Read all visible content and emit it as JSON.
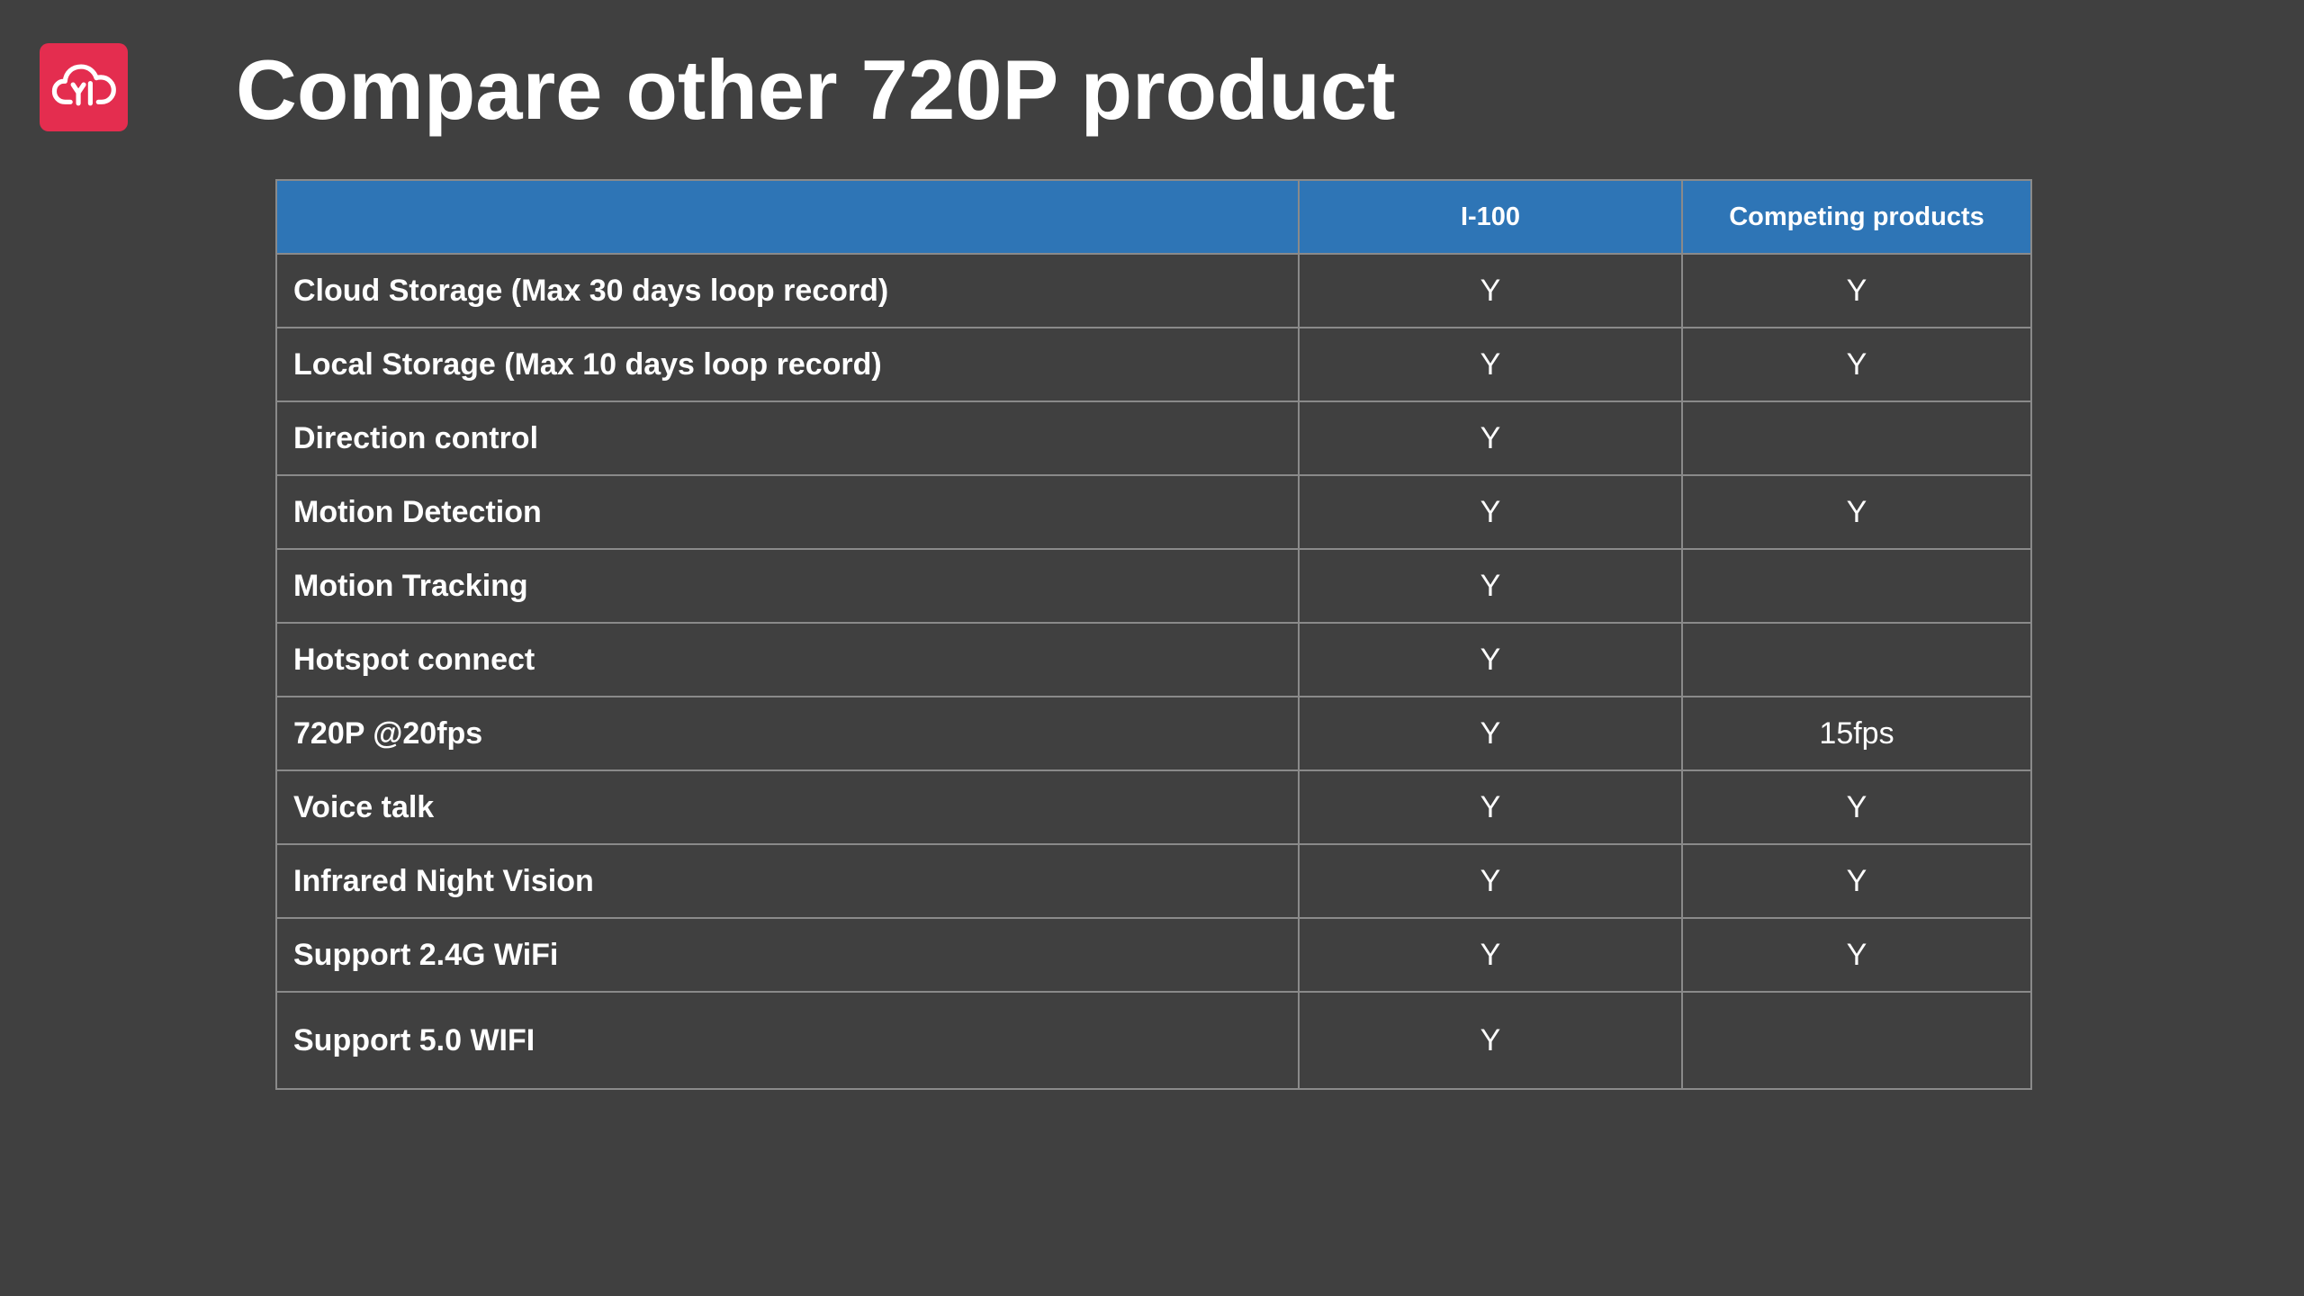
{
  "title": "Compare other 720P product",
  "logo": {
    "icon": "cloud-yi-logo-icon",
    "color": "#e42d4f"
  },
  "colors": {
    "background": "#404040",
    "header": "#2e75b6",
    "grid": "#8a8a8a"
  },
  "table": {
    "headers": [
      "",
      "I-100",
      "Competing products"
    ],
    "rows": [
      {
        "feature": "Cloud Storage (Max 30 days loop record)",
        "i100": "Y",
        "competing": "Y"
      },
      {
        "feature": "Local Storage (Max 10 days loop record)",
        "i100": "Y",
        "competing": "Y"
      },
      {
        "feature": "Direction control",
        "i100": "Y",
        "competing": ""
      },
      {
        "feature": "Motion Detection",
        "i100": "Y",
        "competing": "Y"
      },
      {
        "feature": "Motion Tracking",
        "i100": "Y",
        "competing": ""
      },
      {
        "feature": "Hotspot connect",
        "i100": "Y",
        "competing": ""
      },
      {
        "feature": "720P @20fps",
        "i100": "Y",
        "competing": "15fps"
      },
      {
        "feature": "Voice talk",
        "i100": "Y",
        "competing": "Y"
      },
      {
        "feature": "Infrared Night Vision",
        "i100": "Y",
        "competing": "Y"
      },
      {
        "feature": "Support 2.4G WiFi",
        "i100": "Y",
        "competing": "Y"
      },
      {
        "feature": "Support 5.0 WIFI",
        "i100": "Y",
        "competing": ""
      }
    ]
  }
}
